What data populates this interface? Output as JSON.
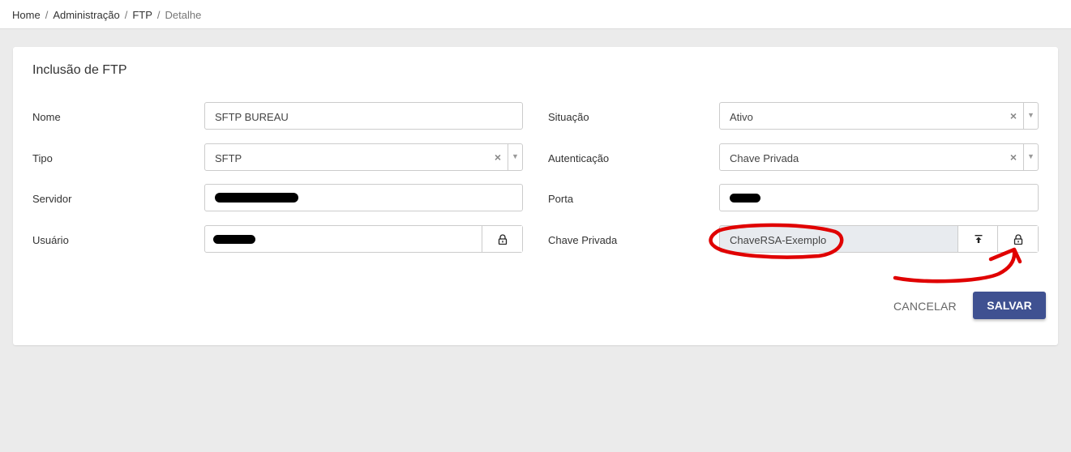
{
  "breadcrumb": {
    "items": [
      "Home",
      "Administração",
      "FTP"
    ],
    "current": "Detalhe",
    "separator": "/"
  },
  "form": {
    "title": "Inclusão de FTP",
    "fields": {
      "nome": {
        "label": "Nome",
        "value": "SFTP BUREAU"
      },
      "situacao": {
        "label": "Situação",
        "value": "Ativo"
      },
      "tipo": {
        "label": "Tipo",
        "value": "SFTP"
      },
      "autenticacao": {
        "label": "Autenticação",
        "value": "Chave Privada"
      },
      "servidor": {
        "label": "Servidor",
        "value": ""
      },
      "porta": {
        "label": "Porta",
        "value": ""
      },
      "usuario": {
        "label": "Usuário",
        "value": ""
      },
      "chave_privada": {
        "label": "Chave Privada",
        "value": "ChaveRSA-Exemplo"
      }
    },
    "select_clear_glyph": "×",
    "select_arrow_glyph": "▼"
  },
  "actions": {
    "cancel_label": "CANCELAR",
    "save_label": "SALVAR"
  },
  "colors": {
    "primary": "#3f5191",
    "annotation": "#e00000",
    "disabled_input": "#e8ebef"
  },
  "icons": {
    "lock": "lock-icon",
    "upload": "upload-icon"
  }
}
